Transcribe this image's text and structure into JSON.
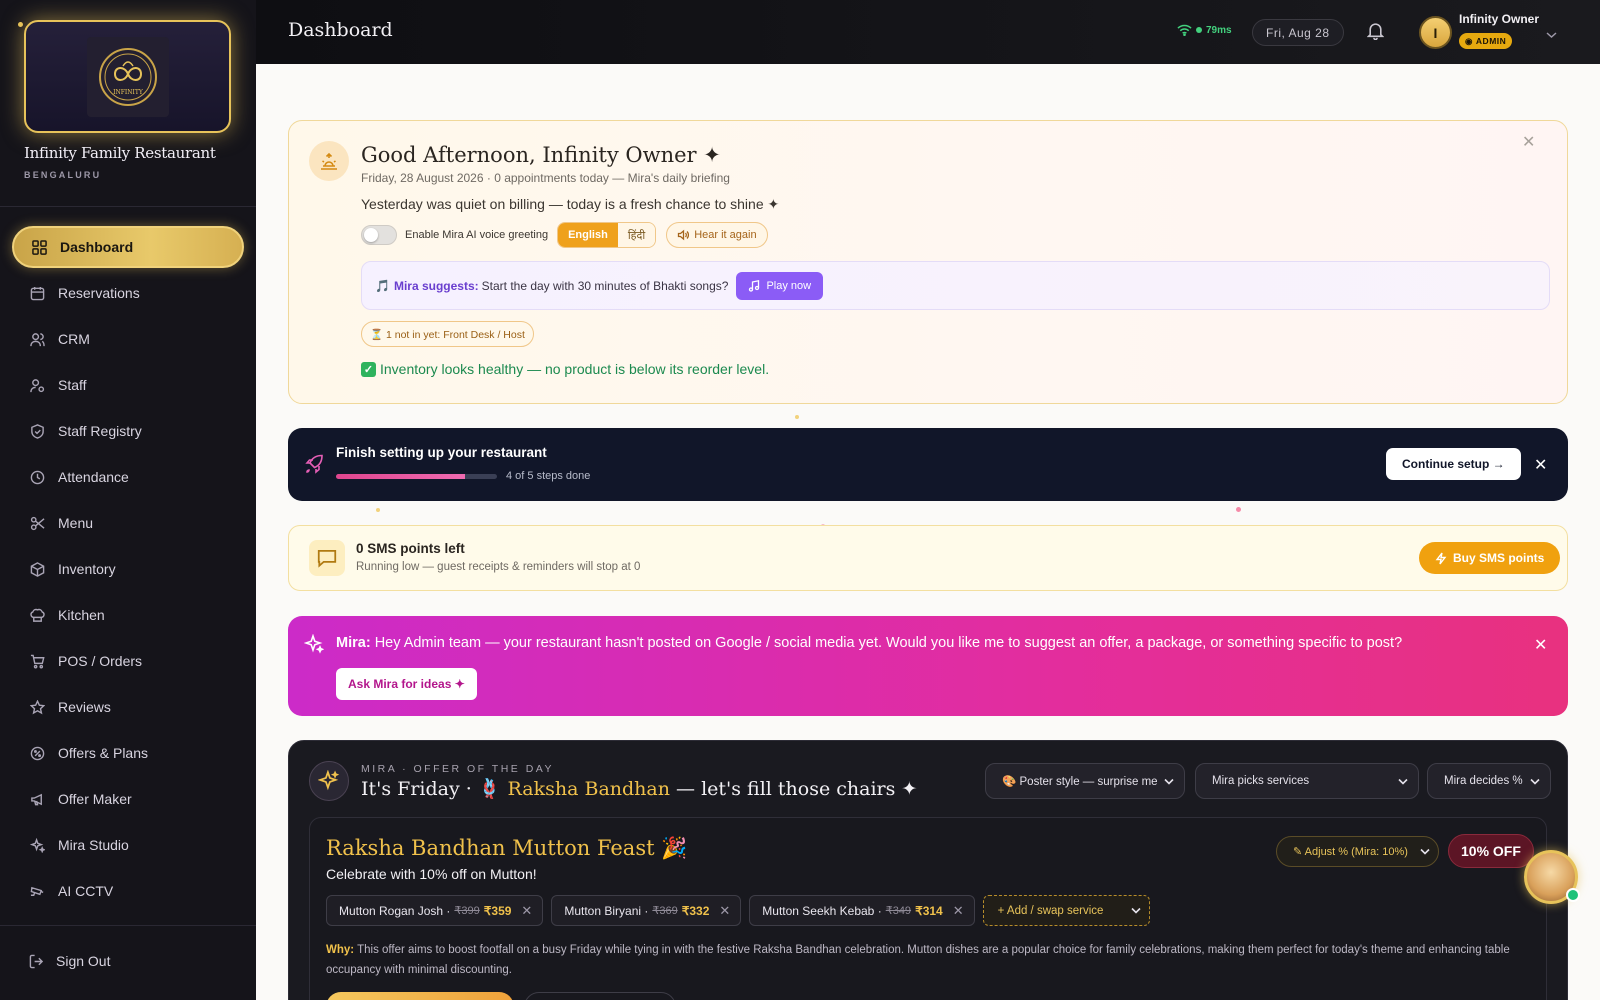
{
  "brand": {
    "name": "Infinity Family Restaurant",
    "city": "BENGALURU",
    "logo_text": "INFINITY"
  },
  "sidebar": {
    "items": [
      {
        "label": "Dashboard",
        "icon": "grid-icon"
      },
      {
        "label": "Reservations",
        "icon": "calendar-icon"
      },
      {
        "label": "CRM",
        "icon": "users-icon"
      },
      {
        "label": "Staff",
        "icon": "user-cog-icon"
      },
      {
        "label": "Staff Registry",
        "icon": "shield-check-icon"
      },
      {
        "label": "Attendance",
        "icon": "clock-icon"
      },
      {
        "label": "Menu",
        "icon": "scissors-icon"
      },
      {
        "label": "Inventory",
        "icon": "box-icon"
      },
      {
        "label": "Kitchen",
        "icon": "chef-hat-icon"
      },
      {
        "label": "POS / Orders",
        "icon": "cart-icon"
      },
      {
        "label": "Reviews",
        "icon": "star-icon"
      },
      {
        "label": "Offers & Plans",
        "icon": "badge-percent-icon"
      },
      {
        "label": "Offer Maker",
        "icon": "megaphone-icon"
      },
      {
        "label": "Mira Studio",
        "icon": "sparkles-icon"
      },
      {
        "label": "AI CCTV",
        "icon": "cctv-icon"
      }
    ],
    "active_index": 0,
    "signout": "Sign Out"
  },
  "header": {
    "title": "Dashboard",
    "latency": "79ms",
    "date": "Fri, Aug 28",
    "user_initial": "I",
    "user_name": "Infinity Owner",
    "role": "ADMIN"
  },
  "greeting": {
    "title": "Good Afternoon, Infinity Owner ✦",
    "subtitle": "Friday, 28 August 2026 · 0 appointments today — Mira's daily briefing",
    "line": "Yesterday was quiet on billing — today is a fresh chance to shine ✦",
    "voice_label": "Enable Mira AI voice greeting",
    "voice_enabled": false,
    "lang_english": "English",
    "lang_hindi": "हिंदी",
    "hear_again": "Hear it again",
    "suggest_prefix": "🎵",
    "suggest_label": "Mira suggests:",
    "suggest_text": "Start the day with 30 minutes of Bhakti songs?",
    "play_now": "Play now",
    "not_in": "⏳ 1 not in yet: Front Desk / Host",
    "inventory_ok": "Inventory looks healthy — no product is below its reorder level."
  },
  "setup": {
    "title": "Finish setting up your restaurant",
    "steps_done": 4,
    "steps_total": 5,
    "steps_label": "4 of 5 steps done",
    "continue": "Continue setup →"
  },
  "sms": {
    "title": "0 SMS points left",
    "subtitle": "Running low — guest receipts & reminders will stop at 0",
    "button": "Buy SMS points"
  },
  "mira_banner": {
    "name": "Mira:",
    "text": "Hey Admin team — your restaurant hasn't posted on Google / social media yet. Would you like me to suggest an offer, a package, or something specific to post?",
    "button": "Ask Mira for ideas ✦"
  },
  "offer": {
    "kicker": "MIRA · OFFER OF THE DAY",
    "head_prefix": "It's Friday · 🪢 ",
    "head_highlight": "Raksha Bandhan",
    "head_suffix": " — let's fill those chairs ✦",
    "style_select": "🎨 Poster style — surprise me",
    "services_select": "Mira picks services",
    "percent_select": "Mira decides %",
    "feast_title": "Raksha Bandhan Mutton Feast 🎉",
    "feast_subtitle": "Celebrate with 10% off on Mutton!",
    "adjust": "✎ Adjust % (Mira: 10%)",
    "discount": "10% OFF",
    "items": [
      {
        "name": "Mutton Rogan Josh ·",
        "old": "₹399",
        "new": "₹359"
      },
      {
        "name": "Mutton Biryani ·",
        "old": "₹369",
        "new": "₹332"
      },
      {
        "name": "Mutton Seekh Kebab ·",
        "old": "₹349",
        "new": "₹314"
      }
    ],
    "add_swap": "+ Add / swap service",
    "why_label": "Why:",
    "why_text": "This offer aims to boost footfall on a busy Friday while tying in with the festive Raksha Bandhan celebration. Mutton dishes are a popular choice for family celebrations, making them perfect for today's theme and enhancing table occupancy with minimal discounting."
  },
  "colors": {
    "accent_gold": "#e7c35a",
    "mira_pink": "#e32d9d",
    "setup_navy": "#111629",
    "success": "#1c8a4f"
  }
}
